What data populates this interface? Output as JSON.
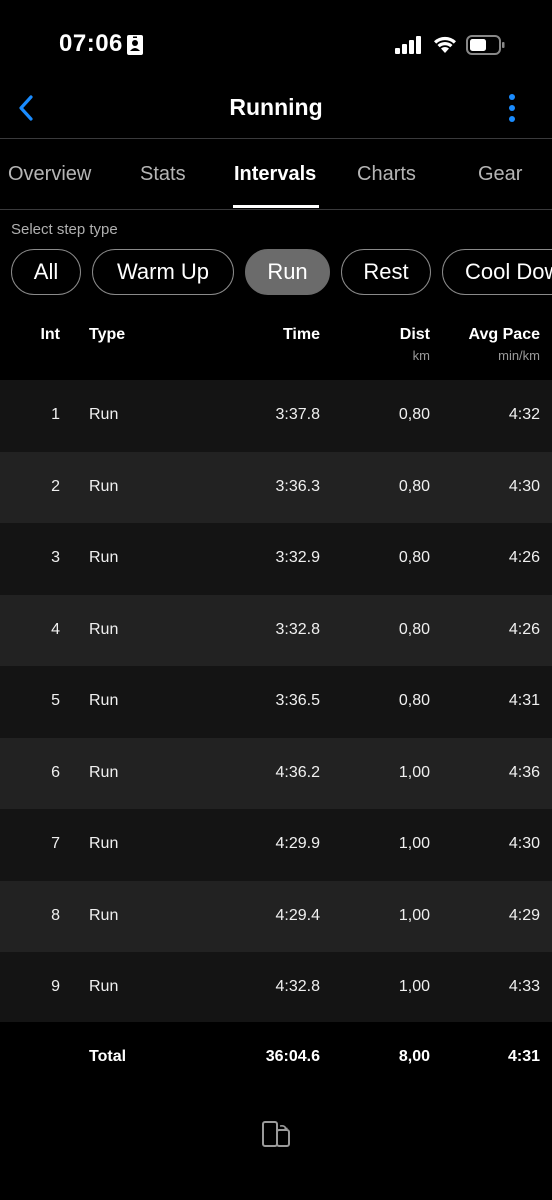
{
  "status_bar": {
    "time": "07:06"
  },
  "header": {
    "title": "Running"
  },
  "tabs": [
    {
      "label": "Overview"
    },
    {
      "label": "Stats"
    },
    {
      "label": "Intervals"
    },
    {
      "label": "Charts"
    },
    {
      "label": "Gear"
    }
  ],
  "active_tab": "Intervals",
  "filter": {
    "label": "Select step type",
    "options": [
      "All",
      "Warm Up",
      "Run",
      "Rest",
      "Cool Down"
    ],
    "selected": "Run"
  },
  "table": {
    "columns": [
      {
        "label": "Int",
        "unit": ""
      },
      {
        "label": "Type",
        "unit": ""
      },
      {
        "label": "Time",
        "unit": ""
      },
      {
        "label": "Dist",
        "unit": "km"
      },
      {
        "label": "Avg Pace",
        "unit": "min/km"
      }
    ],
    "rows": [
      {
        "int": "1",
        "type": "Run",
        "time": "3:37.8",
        "dist": "0,80",
        "pace": "4:32"
      },
      {
        "int": "2",
        "type": "Run",
        "time": "3:36.3",
        "dist": "0,80",
        "pace": "4:30"
      },
      {
        "int": "3",
        "type": "Run",
        "time": "3:32.9",
        "dist": "0,80",
        "pace": "4:26"
      },
      {
        "int": "4",
        "type": "Run",
        "time": "3:32.8",
        "dist": "0,80",
        "pace": "4:26"
      },
      {
        "int": "5",
        "type": "Run",
        "time": "3:36.5",
        "dist": "0,80",
        "pace": "4:31"
      },
      {
        "int": "6",
        "type": "Run",
        "time": "4:36.2",
        "dist": "1,00",
        "pace": "4:36"
      },
      {
        "int": "7",
        "type": "Run",
        "time": "4:29.9",
        "dist": "1,00",
        "pace": "4:30"
      },
      {
        "int": "8",
        "type": "Run",
        "time": "4:29.4",
        "dist": "1,00",
        "pace": "4:29"
      },
      {
        "int": "9",
        "type": "Run",
        "time": "4:32.8",
        "dist": "1,00",
        "pace": "4:33"
      }
    ],
    "total": {
      "label": "Total",
      "time": "36:04.6",
      "dist": "8,00",
      "pace": "4:31"
    }
  },
  "icons": {
    "back": "chevron-left-icon",
    "more": "more-vertical-icon",
    "bottom": "device-rotate-icon"
  },
  "colors": {
    "accent": "#1a8cff",
    "chip_selected": "#6b6b6b",
    "row_dark": "#141414",
    "row_light": "#222222"
  }
}
